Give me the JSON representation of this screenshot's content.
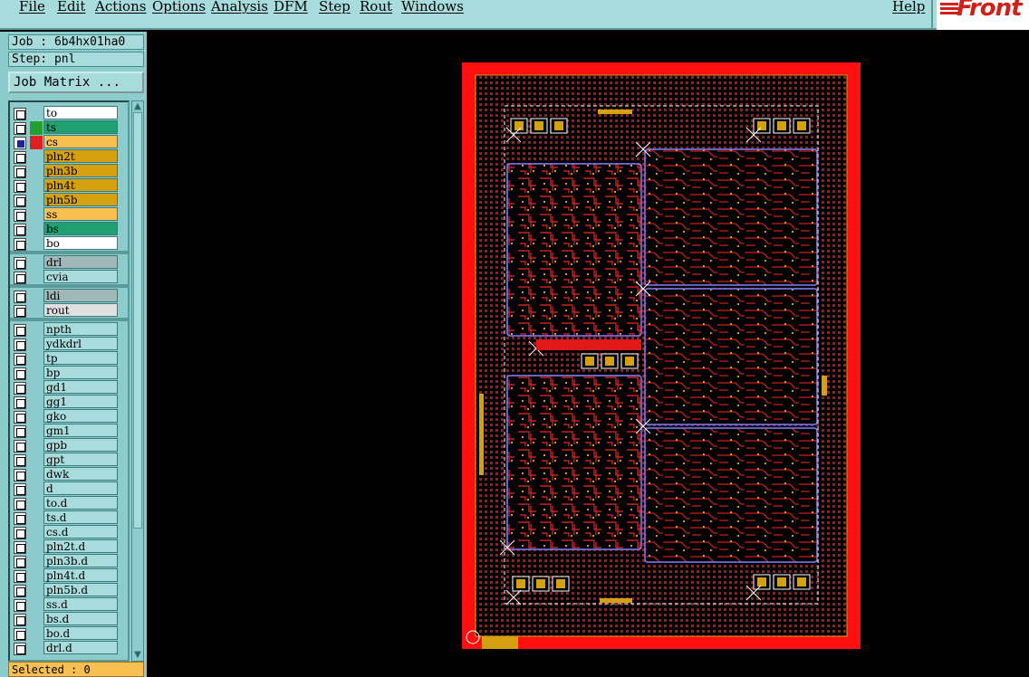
{
  "menu": {
    "items": [
      "File",
      "Edit",
      "Actions",
      "Options",
      "Analysis",
      "DFM",
      "Step",
      "Rout",
      "Windows"
    ],
    "help": "Help"
  },
  "logo": {
    "text": "Front"
  },
  "job": {
    "label": "Job : 6b4hx01ha0",
    "step": "Step: pnl"
  },
  "job_matrix_label": "Job Matrix ...",
  "layers": [
    {
      "name": "to",
      "color": "#ffffff",
      "swatch": "#8ccccc"
    },
    {
      "name": "ts",
      "color": "#20a070",
      "swatch": "#20a030"
    },
    {
      "name": "cs",
      "color": "#f8c050",
      "swatch": "#e02020",
      "selected": true
    },
    {
      "name": "pln2t",
      "color": "#d4a010",
      "swatch": "#8ccccc"
    },
    {
      "name": "pln3b",
      "color": "#d4a010",
      "swatch": "#8ccccc"
    },
    {
      "name": "pln4t",
      "color": "#d4a010",
      "swatch": "#8ccccc"
    },
    {
      "name": "pln5b",
      "color": "#d4a010",
      "swatch": "#8ccccc"
    },
    {
      "name": "ss",
      "color": "#f8c050",
      "swatch": "#8ccccc"
    },
    {
      "name": "bs",
      "color": "#20a070",
      "swatch": "#8ccccc"
    },
    {
      "name": "bo",
      "color": "#ffffff",
      "swatch": "#8ccccc"
    },
    {
      "name": "drl",
      "color": "#a0b8b8",
      "swatch": "#8ccccc"
    },
    {
      "name": "cvia",
      "color": "#a8dcdc",
      "swatch": "#8ccccc"
    },
    {
      "name": "ldi",
      "color": "#a0b8b8",
      "swatch": "#8ccccc"
    },
    {
      "name": "rout",
      "color": "#e0e0e0",
      "swatch": "#8ccccc"
    },
    {
      "name": "npth",
      "color": "#a8dcdc",
      "swatch": "#8ccccc"
    },
    {
      "name": "ydkdrl",
      "color": "#a8dcdc",
      "swatch": "#8ccccc"
    },
    {
      "name": "tp",
      "color": "#a8dcdc",
      "swatch": "#8ccccc"
    },
    {
      "name": "bp",
      "color": "#a8dcdc",
      "swatch": "#8ccccc"
    },
    {
      "name": "gd1",
      "color": "#a8dcdc",
      "swatch": "#8ccccc"
    },
    {
      "name": "gg1",
      "color": "#a8dcdc",
      "swatch": "#8ccccc"
    },
    {
      "name": "gko",
      "color": "#a8dcdc",
      "swatch": "#8ccccc"
    },
    {
      "name": "gm1",
      "color": "#a8dcdc",
      "swatch": "#8ccccc"
    },
    {
      "name": "gpb",
      "color": "#a8dcdc",
      "swatch": "#8ccccc"
    },
    {
      "name": "gpt",
      "color": "#a8dcdc",
      "swatch": "#8ccccc"
    },
    {
      "name": "dwk",
      "color": "#a8dcdc",
      "swatch": "#8ccccc"
    },
    {
      "name": "d",
      "color": "#a8dcdc",
      "swatch": "#8ccccc"
    },
    {
      "name": "to.d",
      "color": "#a8dcdc",
      "swatch": "#8ccccc"
    },
    {
      "name": "ts.d",
      "color": "#a8dcdc",
      "swatch": "#8ccccc"
    },
    {
      "name": "cs.d",
      "color": "#a8dcdc",
      "swatch": "#8ccccc"
    },
    {
      "name": "pln2t.d",
      "color": "#a8dcdc",
      "swatch": "#8ccccc"
    },
    {
      "name": "pln3b.d",
      "color": "#a8dcdc",
      "swatch": "#8ccccc"
    },
    {
      "name": "pln4t.d",
      "color": "#a8dcdc",
      "swatch": "#8ccccc"
    },
    {
      "name": "pln5b.d",
      "color": "#a8dcdc",
      "swatch": "#8ccccc"
    },
    {
      "name": "ss.d",
      "color": "#a8dcdc",
      "swatch": "#8ccccc"
    },
    {
      "name": "bs.d",
      "color": "#a8dcdc",
      "swatch": "#8ccccc"
    },
    {
      "name": "bo.d",
      "color": "#a8dcdc",
      "swatch": "#8ccccc"
    },
    {
      "name": "drl.d",
      "color": "#a8dcdc",
      "swatch": "#8ccccc"
    }
  ],
  "status": "Selected : 0",
  "colors": {
    "panel_frame": "#ff1010",
    "copper": "#c82020",
    "pad": "#d4a010",
    "outline": "#8080ff",
    "board_bg": "#000000"
  }
}
